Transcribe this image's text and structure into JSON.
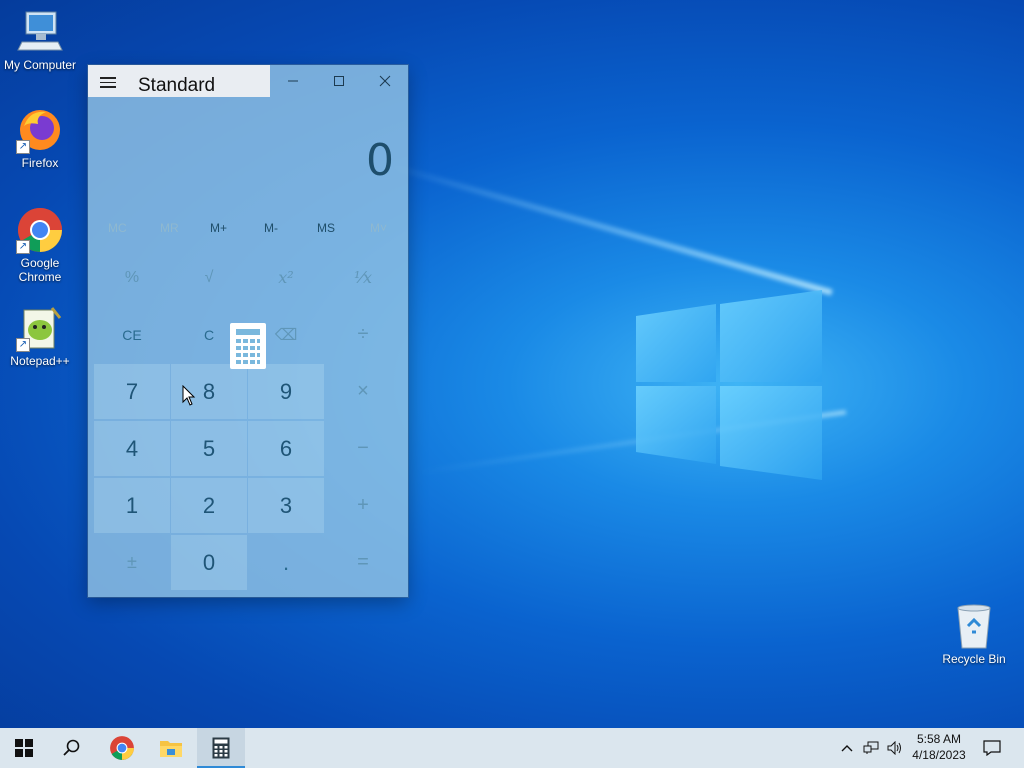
{
  "desktop": {
    "icons": [
      {
        "label": "My Computer"
      },
      {
        "label": "Firefox"
      },
      {
        "label": "Google Chrome"
      },
      {
        "label": "Notepad++"
      },
      {
        "label": "Recycle Bin"
      }
    ]
  },
  "calculator": {
    "mode_title": "Standard",
    "display_value": "0",
    "memory_buttons": [
      "MC",
      "MR",
      "M+",
      "M-",
      "MS",
      "M˅"
    ],
    "keys": {
      "percent": "%",
      "sqrt": "√",
      "square": "x²",
      "reciprocal": "¹⁄x",
      "ce": "CE",
      "c": "C",
      "backspace": "⌫",
      "divide": "÷",
      "seven": "7",
      "eight": "8",
      "nine": "9",
      "multiply": "×",
      "four": "4",
      "five": "5",
      "six": "6",
      "minus": "−",
      "one": "1",
      "two": "2",
      "three": "3",
      "plus": "+",
      "negate": "±",
      "zero": "0",
      "decimal": ".",
      "equals": "="
    }
  },
  "taskbar": {
    "clock_time": "5:58 AM",
    "clock_date": "4/18/2023"
  },
  "colors": {
    "accent": "#2f8ad6",
    "taskbar_bg": "#dbe6ee"
  }
}
